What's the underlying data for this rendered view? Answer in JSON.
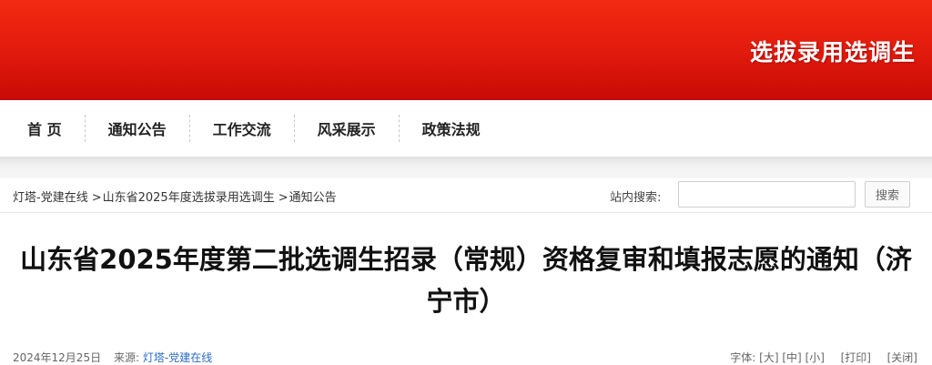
{
  "banner": {
    "title": "选拔录用选调生"
  },
  "nav": {
    "items": [
      {
        "label": "首 页"
      },
      {
        "label": "通知公告"
      },
      {
        "label": "工作交流"
      },
      {
        "label": "风采展示"
      },
      {
        "label": "政策法规"
      }
    ]
  },
  "breadcrumb": {
    "items": [
      {
        "label": "灯塔-党建在线"
      },
      {
        "label": "山东省2025年度选拔录用选调生"
      },
      {
        "label": "通知公告"
      }
    ],
    "separator": ">"
  },
  "search": {
    "label": "站内搜索:",
    "value": "",
    "placeholder": "",
    "button_label": "搜索"
  },
  "article": {
    "title": "山东省2025年度第二批选调生招录（常规）资格复审和填报志愿的通知（济宁市）",
    "date": "2024年12月25日",
    "source_label": "来源:",
    "source_name": "灯塔-党建在线",
    "font_size_label": "字体:",
    "size_large": "[大]",
    "size_medium": "[中]",
    "size_small": "[小]",
    "print_label": "[打印]",
    "close_label": "[关闭]"
  },
  "colors": {
    "banner_red": "#e01a0c",
    "link_blue": "#2a6ac8"
  }
}
